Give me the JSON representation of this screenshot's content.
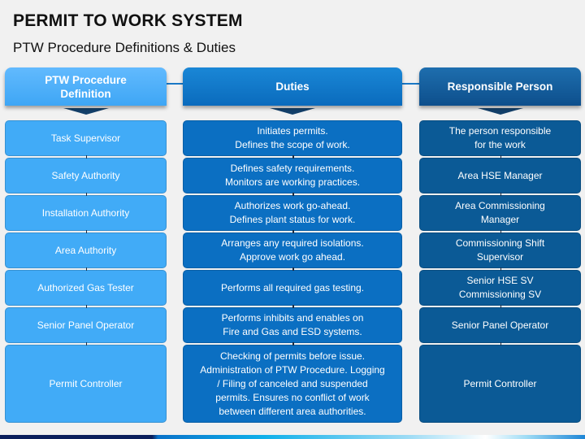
{
  "title": "PERMIT TO WORK SYSTEM",
  "subtitle": "PTW Procedure Definitions & Duties",
  "columns": [
    {
      "header": "PTW Procedure\nDefinition",
      "items": [
        "Task Supervisor",
        "Safety Authority",
        "Installation Authority",
        "Area Authority",
        "Authorized Gas Tester",
        "Senior Panel Operator",
        "Permit Controller"
      ]
    },
    {
      "header": "Duties",
      "items": [
        "Initiates permits.\nDefines the scope of work.",
        "Defines safety requirements.\nMonitors are working practices.",
        "Authorizes work go-ahead.\nDefines plant status for work.",
        "Arranges any required isolations.\nApprove work go ahead.",
        "Performs all required gas testing.",
        "Performs inhibits and enables on\nFire and Gas and ESD systems.",
        "Checking of permits before issue.\nAdministration of PTW Procedure. Logging\n/ Filing of canceled and suspended\npermits. Ensures no conflict of work\nbetween different area authorities."
      ]
    },
    {
      "header": "Responsible Person",
      "items": [
        "The person responsible\nfor the work",
        "Area HSE Manager",
        "Area Commissioning\nManager",
        "Commissioning Shift\nSupervisor",
        "Senior HSE SV\nCommissioning SV",
        "Senior Panel Operator",
        "Permit Controller"
      ]
    }
  ],
  "colors": {
    "col1": "#41abf7",
    "col2": "#0b6fc2",
    "col3": "#0b5a96",
    "background": "#f1f1f1"
  }
}
